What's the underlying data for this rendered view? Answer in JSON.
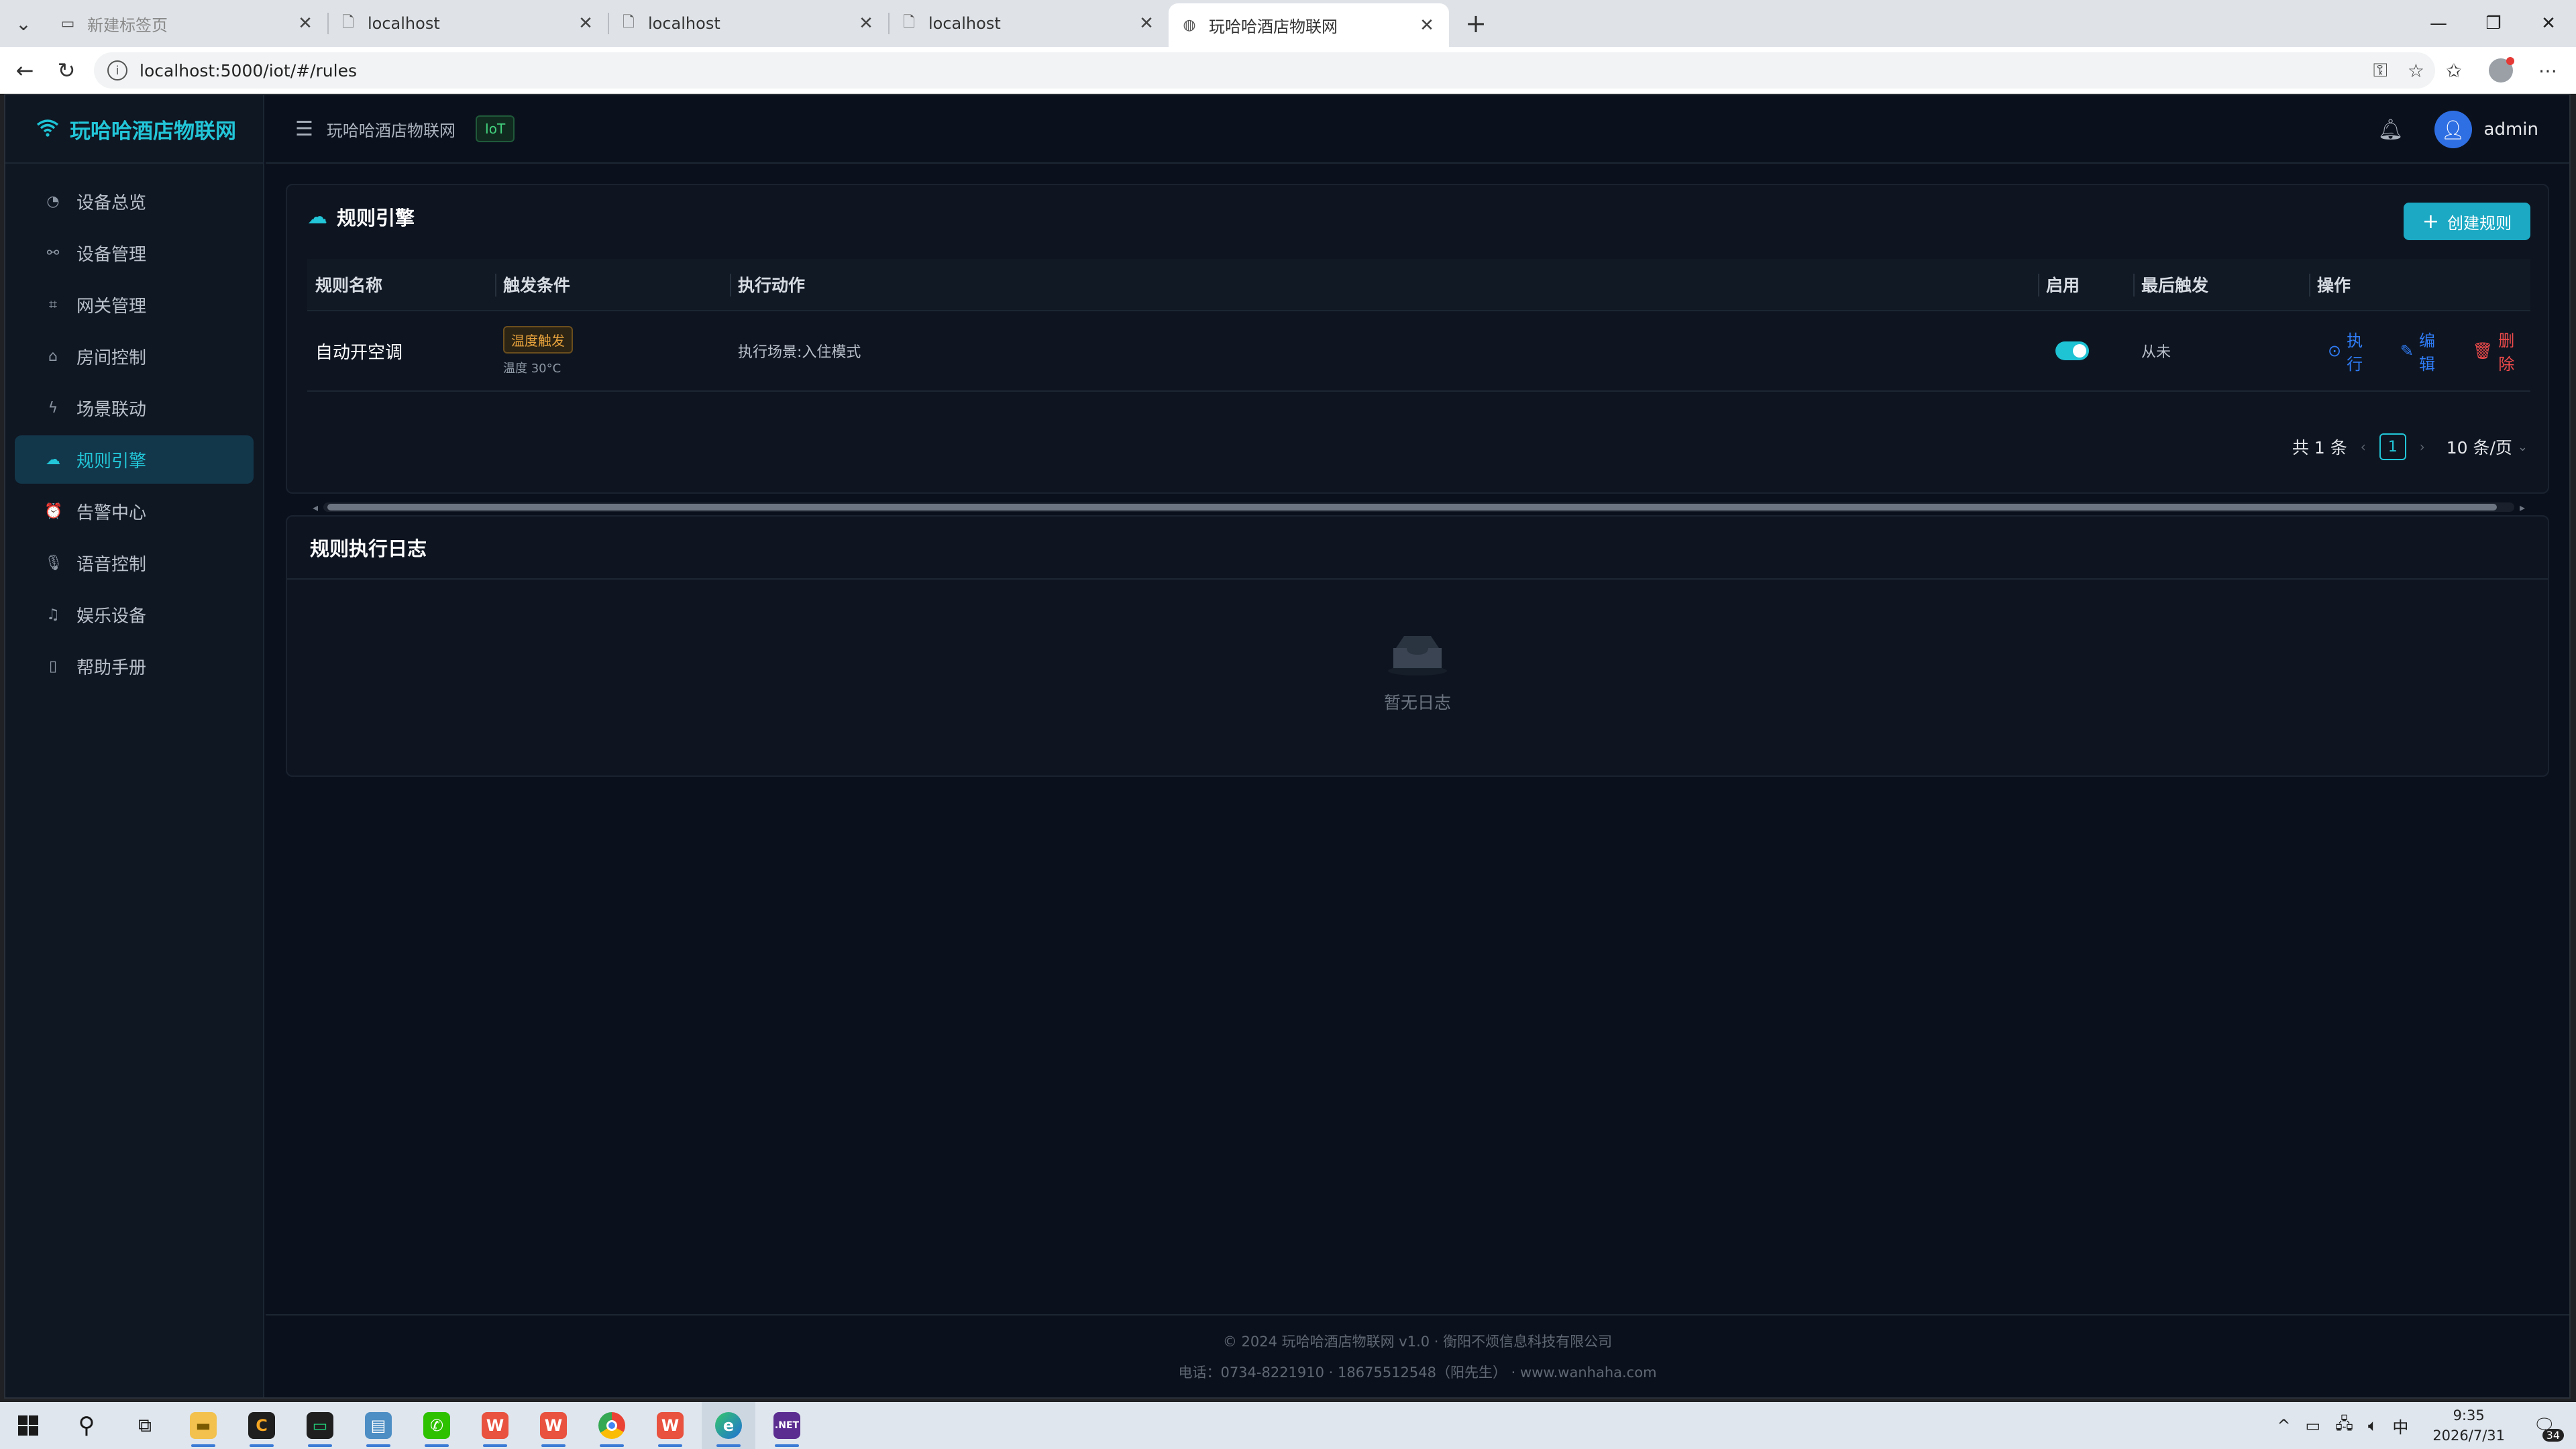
{
  "browser": {
    "tabs": [
      {
        "title": "新建标签页",
        "icon": "new-tab-page-icon",
        "muted": true
      },
      {
        "title": "localhost",
        "icon": "page-icon",
        "muted": false
      },
      {
        "title": "localhost",
        "icon": "page-icon",
        "muted": false
      },
      {
        "title": "localhost",
        "icon": "page-icon",
        "muted": false
      },
      {
        "title": "玩哈哈酒店物联网",
        "icon": "globe-icon",
        "muted": false,
        "active": true
      }
    ],
    "url": "localhost:5000/iot/#/rules"
  },
  "app": {
    "brand": "玩哈哈酒店物联网",
    "breadcrumb": "玩哈哈酒店物联网",
    "tag": "IoT",
    "user": "admin",
    "menu": [
      {
        "label": "设备总览",
        "icon": "dashboard-icon"
      },
      {
        "label": "设备管理",
        "icon": "link-icon"
      },
      {
        "label": "网关管理",
        "icon": "gateway-icon"
      },
      {
        "label": "房间控制",
        "icon": "home-icon"
      },
      {
        "label": "场景联动",
        "icon": "lightning-icon"
      },
      {
        "label": "规则引擎",
        "icon": "cloud-icon",
        "active": true
      },
      {
        "label": "告警中心",
        "icon": "alarm-icon"
      },
      {
        "label": "语音控制",
        "icon": "microphone-icon"
      },
      {
        "label": "娱乐设备",
        "icon": "entertainment-icon"
      },
      {
        "label": "帮助手册",
        "icon": "book-icon"
      }
    ]
  },
  "rules": {
    "title": "规则引擎",
    "create_label": "创建规则",
    "columns": [
      "规则名称",
      "触发条件",
      "执行动作",
      "启用",
      "最后触发",
      "操作"
    ],
    "rows": [
      {
        "name": "自动开空调",
        "trigger_tag": "温度触发",
        "trigger_detail": "温度 30°C",
        "action": "执行场景:入住模式",
        "enabled": true,
        "last": "从未",
        "ops": {
          "run": "执行",
          "edit": "编辑",
          "delete": "删除"
        }
      }
    ],
    "pager": {
      "total": "共 1 条",
      "page": "1",
      "size": "10 条/页"
    }
  },
  "logs": {
    "title": "规则执行日志",
    "empty": "暂无日志"
  },
  "footer": {
    "line1": "© 2024 玩哈哈酒店物联网 v1.0 · 衡阳不烦信息科技有限公司",
    "line2": "电话：0734-8221910 · 18675512548（阳先生） · www.wanhaha.com"
  },
  "taskbar": {
    "time": "9:35",
    "date": "2026/7/31",
    "ime": "中",
    "notifications": "34"
  }
}
